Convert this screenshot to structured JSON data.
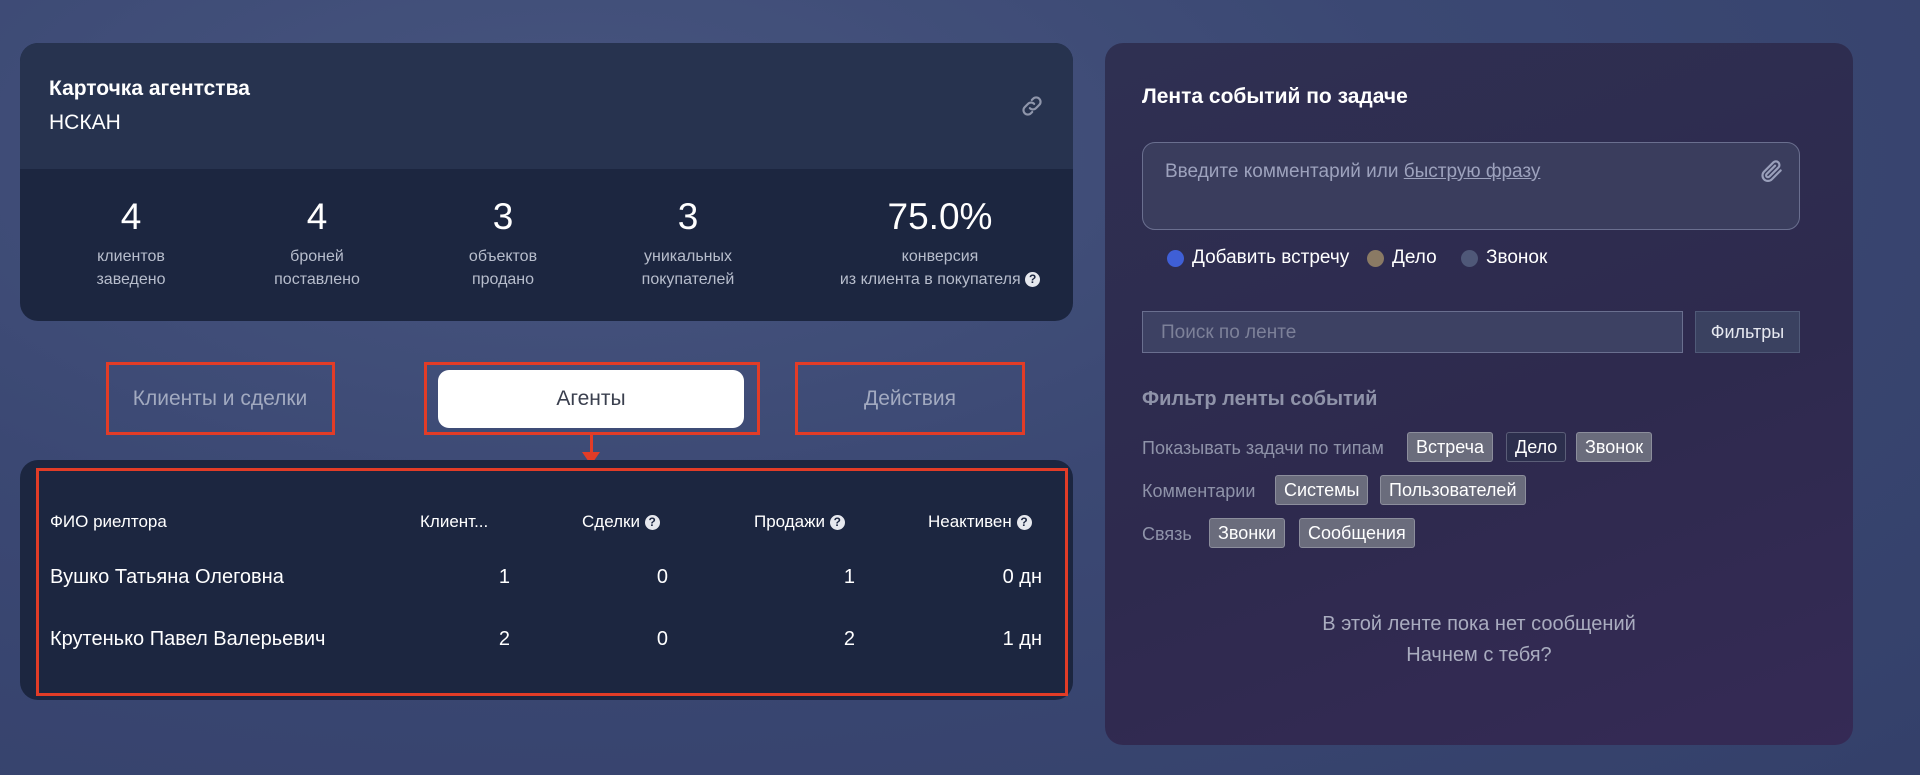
{
  "agency": {
    "title": "Карточка агентства",
    "name": "НСКАН",
    "stats": [
      {
        "value": "4",
        "label1": "клиентов",
        "label2": "заведено"
      },
      {
        "value": "4",
        "label1": "броней",
        "label2": "поставлено"
      },
      {
        "value": "3",
        "label1": "объектов",
        "label2": "продано"
      },
      {
        "value": "3",
        "label1": "уникальных",
        "label2": "покупателей"
      },
      {
        "value": "75.0%",
        "label1": "конверсия",
        "label2": "из клиента в покупателя"
      }
    ]
  },
  "tabs": [
    {
      "label": "Клиенты и сделки"
    },
    {
      "label": "Агенты"
    },
    {
      "label": "Действия"
    }
  ],
  "agents_table": {
    "columns": [
      "ФИО риелтора",
      "Клиент...",
      "Сделки",
      "Продажи",
      "Неактивен"
    ],
    "rows": [
      {
        "name": "Вушко Татьяна Олеговна",
        "clients": "1",
        "deals": "0",
        "sales": "1",
        "inactive": "0 дн"
      },
      {
        "name": "Крутенько Павел Валерьевич",
        "clients": "2",
        "deals": "0",
        "sales": "2",
        "inactive": "1 дн"
      }
    ]
  },
  "feed": {
    "title": "Лента событий по задаче",
    "comment_placeholder": "Введите комментарий или ",
    "quick_phrase_link": "быструю фразу",
    "types": [
      {
        "label": "Добавить встречу",
        "color": "#3f5fd6"
      },
      {
        "label": "Дело",
        "color": "#8a7a64"
      },
      {
        "label": "Звонок",
        "color": "#4f5878"
      }
    ],
    "search_placeholder": "Поиск по ленте",
    "filters_button": "Фильтры",
    "filter_heading": "Фильтр ленты событий",
    "filter_rows": {
      "task_types": {
        "label": "Показывать задачи по типам",
        "chips": [
          "Встреча",
          "Дело",
          "Звонок"
        ]
      },
      "comments": {
        "label": "Комментарии",
        "chips": [
          "Системы",
          "Пользователей"
        ]
      },
      "connection": {
        "label": "Связь",
        "chips": [
          "Звонки",
          "Сообщения"
        ]
      }
    },
    "empty_line1": "В этой ленте пока нет сообщений",
    "empty_line2": "Начнем с тебя?"
  },
  "colors": {
    "highlight": "#e23c27",
    "card": "#1c2640"
  }
}
